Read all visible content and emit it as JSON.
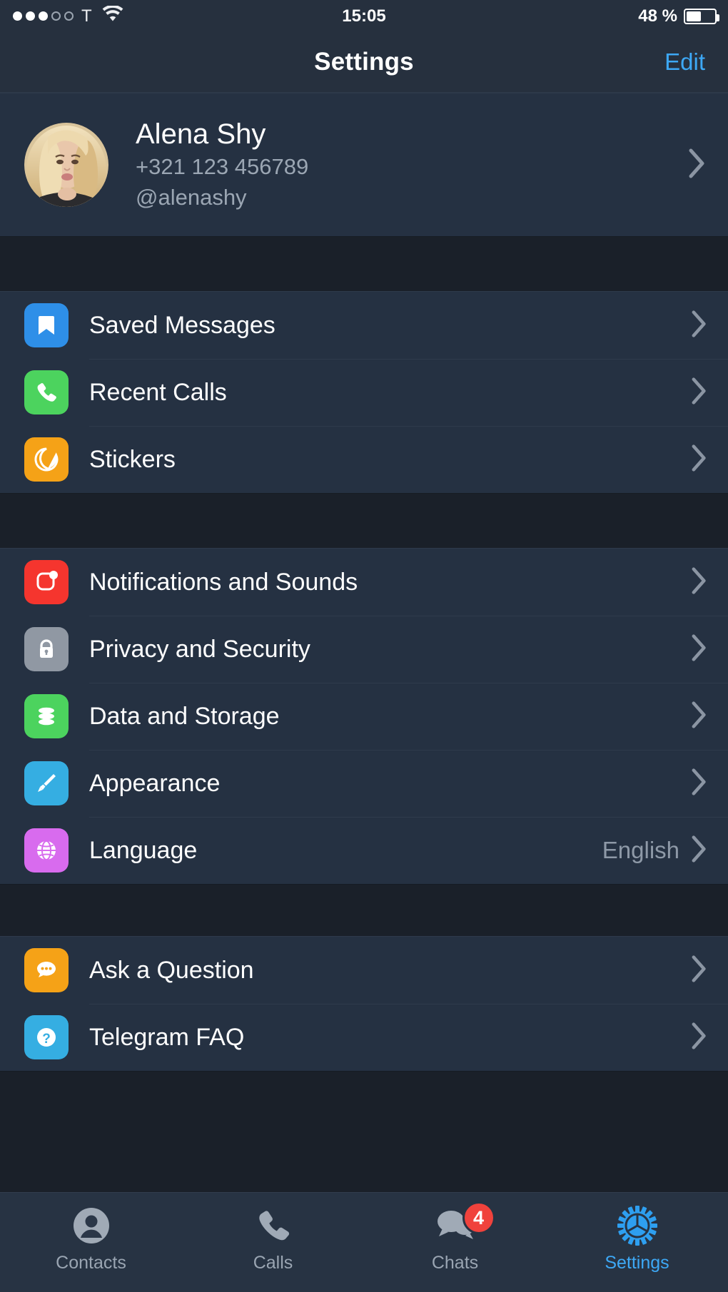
{
  "status_bar": {
    "signal_filled": 3,
    "signal_empty": 2,
    "carrier": "T",
    "wifi_icon": "wifi-icon",
    "time": "15:05",
    "battery_text": "48 %",
    "battery_level": 48
  },
  "nav": {
    "title": "Settings",
    "edit_label": "Edit"
  },
  "profile": {
    "name": "Alena Shy",
    "phone": "+321 123 456789",
    "username": "@alenashy",
    "avatar_name": "avatar"
  },
  "groups": [
    {
      "id": "group-media",
      "rows": [
        {
          "id": "saved-messages",
          "label": "Saved Messages",
          "icon": "bookmark-icon",
          "icon_color": "#2E8FE8",
          "value": ""
        },
        {
          "id": "recent-calls",
          "label": "Recent Calls",
          "icon": "phone-icon",
          "icon_color": "#4CD35E",
          "value": ""
        },
        {
          "id": "stickers",
          "label": "Stickers",
          "icon": "sticker-icon",
          "icon_color": "#F5A217",
          "value": ""
        }
      ]
    },
    {
      "id": "group-preferences",
      "rows": [
        {
          "id": "notifications-and-sounds",
          "label": "Notifications and Sounds",
          "icon": "notification-icon",
          "icon_color": "#F5352E",
          "value": ""
        },
        {
          "id": "privacy-and-security",
          "label": "Privacy and Security",
          "icon": "lock-icon",
          "icon_color": "#9098A3",
          "value": ""
        },
        {
          "id": "data-and-storage",
          "label": "Data and Storage",
          "icon": "database-icon",
          "icon_color": "#4CD35E",
          "value": ""
        },
        {
          "id": "appearance",
          "label": "Appearance",
          "icon": "paintbrush-icon",
          "icon_color": "#35AEE2",
          "value": ""
        },
        {
          "id": "language",
          "label": "Language",
          "icon": "globe-icon",
          "icon_color": "#D86BEE",
          "value": "English"
        }
      ]
    },
    {
      "id": "group-help",
      "rows": [
        {
          "id": "ask-a-question",
          "label": "Ask a Question",
          "icon": "speech-bubble-icon",
          "icon_color": "#F5A217",
          "value": ""
        },
        {
          "id": "telegram-faq",
          "label": "Telegram FAQ",
          "icon": "question-icon",
          "icon_color": "#35AEE2",
          "value": ""
        }
      ]
    }
  ],
  "tabs": [
    {
      "id": "contacts",
      "label": "Contacts",
      "icon": "contacts-icon",
      "active": false,
      "badge": ""
    },
    {
      "id": "calls",
      "label": "Calls",
      "icon": "phone-icon",
      "active": false,
      "badge": ""
    },
    {
      "id": "chats",
      "label": "Chats",
      "icon": "chats-icon",
      "active": false,
      "badge": "4"
    },
    {
      "id": "settings",
      "label": "Settings",
      "icon": "gear-icon",
      "active": true,
      "badge": ""
    }
  ],
  "colors": {
    "accent": "#3DA8F5",
    "row_bg": "#253142",
    "page_bg": "#1A2029",
    "bar_bg": "#26303E",
    "badge": "#F0423C"
  }
}
